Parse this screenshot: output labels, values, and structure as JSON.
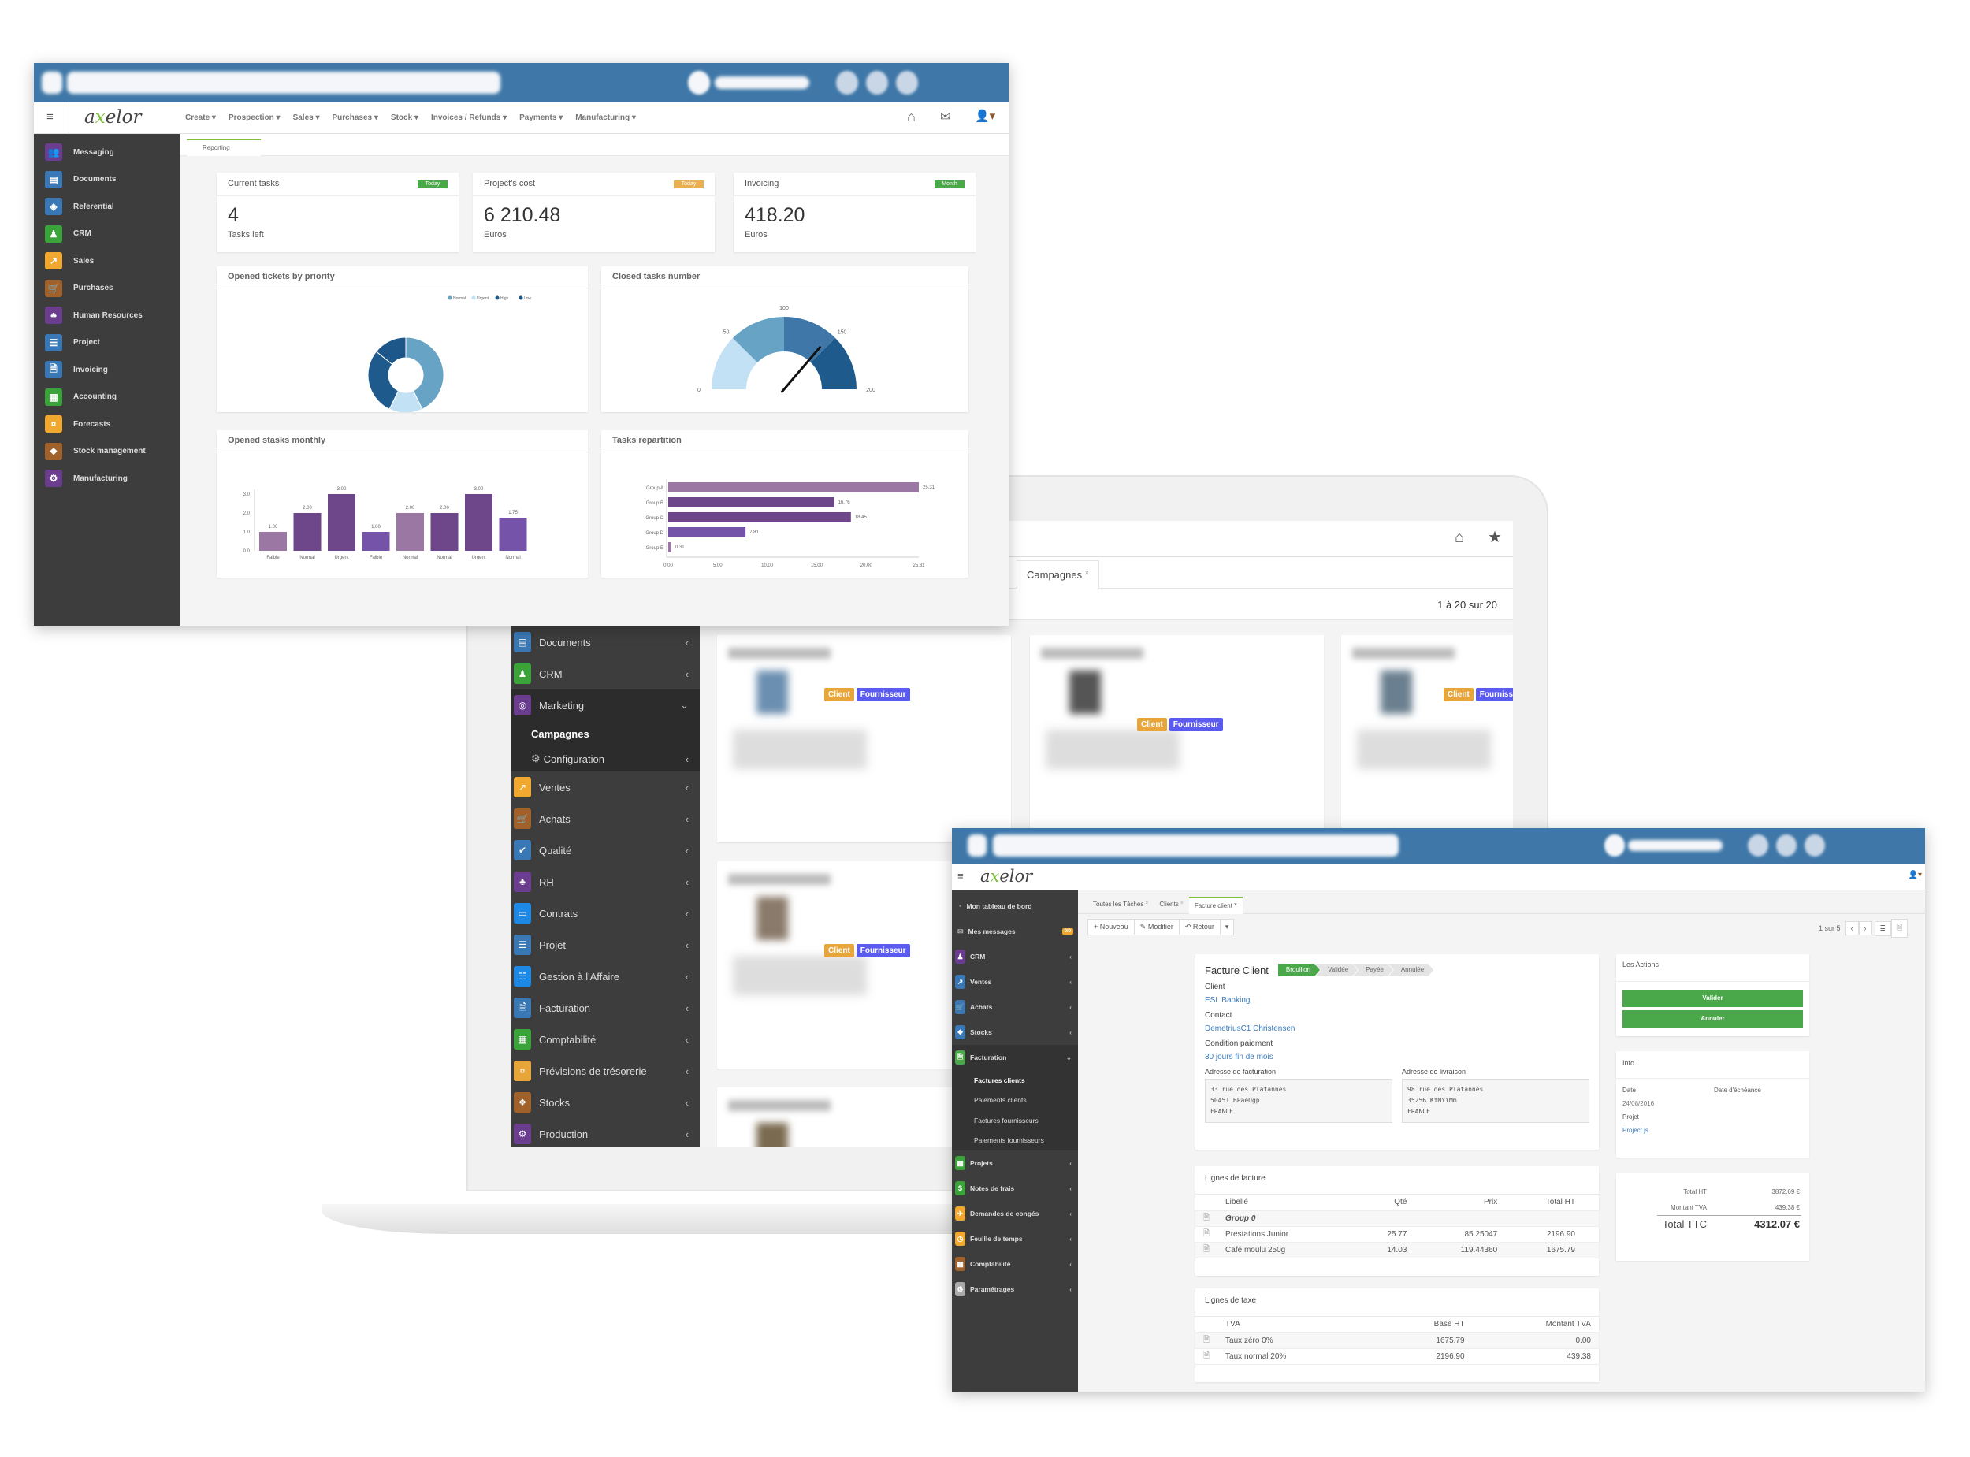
{
  "dashboard": {
    "logo": "axelor",
    "menu": [
      "Create",
      "Prospection",
      "Sales",
      "Purchases",
      "Stock",
      "Invoices / Refunds",
      "Payments",
      "Manufacturing"
    ],
    "tab": "Reporting",
    "sidebar": [
      {
        "label": "Messaging",
        "color": "#6a3d8f",
        "icon": "users-icon"
      },
      {
        "label": "Documents",
        "color": "#3a78b5",
        "icon": "document-icon"
      },
      {
        "label": "Referential",
        "color": "#3a78b5",
        "icon": "cube-icon"
      },
      {
        "label": "CRM",
        "color": "#3aa33a",
        "icon": "user-icon"
      },
      {
        "label": "Sales",
        "color": "#f0a830",
        "icon": "chart-line-icon"
      },
      {
        "label": "Purchases",
        "color": "#a0612a",
        "icon": "cart-icon"
      },
      {
        "label": "Human Resources",
        "color": "#6a3d8f",
        "icon": "sitemap-icon"
      },
      {
        "label": "Project",
        "color": "#3a78b5",
        "icon": "tasks-icon"
      },
      {
        "label": "Invoicing",
        "color": "#3a78b5",
        "icon": "invoice-icon"
      },
      {
        "label": "Accounting",
        "color": "#3aa33a",
        "icon": "calculator-icon"
      },
      {
        "label": "Forecasts",
        "color": "#f0a830",
        "icon": "money-icon"
      },
      {
        "label": "Stock management",
        "color": "#a0612a",
        "icon": "boxes-icon"
      },
      {
        "label": "Manufacturing",
        "color": "#6a3d8f",
        "icon": "cogs-icon"
      }
    ],
    "kpis": [
      {
        "title": "Current tasks",
        "tag": "Today",
        "tag_color": "#4aa84a",
        "value": "4",
        "unit": "Tasks left"
      },
      {
        "title": "Project's cost",
        "tag": "Today",
        "tag_color": "#e8b050",
        "value": "6 210.48",
        "unit": "Euros"
      },
      {
        "title": "Invoicing",
        "tag": "Month",
        "tag_color": "#4aa84a",
        "value": "418.20",
        "unit": "Euros"
      }
    ]
  },
  "chart_data": [
    {
      "type": "pie",
      "title": "Opened tickets by priority",
      "donut": true,
      "legend": "top-right",
      "slices": [
        {
          "name": "Normal",
          "value": 3,
          "color": "#67a3c4"
        },
        {
          "name": "Urgent",
          "value": 1,
          "color": "#c3e1f5"
        },
        {
          "name": "High",
          "value": 2,
          "color": "#1f5a8c"
        },
        {
          "name": "Low",
          "value": 1,
          "color": "#1d5689"
        }
      ]
    },
    {
      "type": "gauge",
      "title": "Closed tasks number",
      "range": [
        0,
        200
      ],
      "ticks": [
        "0",
        "50",
        "100",
        "150",
        "200"
      ],
      "value": 145,
      "bands": [
        {
          "from": 0,
          "to": 50,
          "color": "#c3e1f5"
        },
        {
          "from": 50,
          "to": 100,
          "color": "#67a3c4"
        },
        {
          "from": 100,
          "to": 150,
          "color": "#3f78a8"
        },
        {
          "from": 150,
          "to": 200,
          "color": "#1f5a8c"
        }
      ]
    },
    {
      "type": "bar",
      "title": "Opened stasks monthly",
      "categories": [
        "Faible",
        "Normal",
        "Urgent",
        "Faible",
        "Normal",
        "Normal",
        "Urgent",
        "Normal"
      ],
      "values": [
        1.0,
        2.0,
        3.0,
        1.0,
        2.0,
        2.0,
        3.0,
        1.75
      ],
      "labels": [
        "1.00",
        "2.00",
        "3.00",
        "1.00",
        "2.00",
        "2.00",
        "3.00",
        "1.75"
      ],
      "colors": [
        "#9a78a3",
        "#6e468a",
        "#6e468a",
        "#7553a8",
        "#9a78a3",
        "#6e468a",
        "#6e468a",
        "#7553a8"
      ],
      "ylim": [
        0,
        3
      ],
      "yticks": [
        "0.0",
        "1.0",
        "2.0",
        "3.0"
      ]
    },
    {
      "type": "bar",
      "orientation": "horizontal",
      "title": "Tasks repartition",
      "categories": [
        "Group A",
        "Group B",
        "Group C",
        "Group D",
        "Group E"
      ],
      "values": [
        25.31,
        16.76,
        18.45,
        7.81,
        0.31
      ],
      "labels": [
        "25.31",
        "16.76",
        "18.45",
        "7.81",
        "0.31"
      ],
      "colors": [
        "#9a78a3",
        "#6e468a",
        "#6e468a",
        "#7553a8",
        "#9a78a3"
      ],
      "xlim": [
        0,
        25.31
      ],
      "xticks": [
        "0.00",
        "5.00",
        "10.00",
        "15.00",
        "20.00",
        "25.31"
      ]
    }
  ],
  "laptop": {
    "tab": "Campagnes",
    "pager": "1 à 20 sur 20",
    "sidebar": [
      {
        "label": "Documents",
        "color": "#3a78b5",
        "icon": "document-icon"
      },
      {
        "label": "CRM",
        "color": "#3aa33a",
        "icon": "user-icon"
      },
      {
        "label": "Marketing",
        "color": "#6a3d8f",
        "icon": "bullseye-icon",
        "expanded": true
      },
      {
        "label": "Campagnes",
        "sub": true,
        "active": true
      },
      {
        "label": "Configuration",
        "sub": true,
        "icon": "gear-icon"
      },
      {
        "label": "Ventes",
        "color": "#f0a830",
        "icon": "chart-line-icon"
      },
      {
        "label": "Achats",
        "color": "#a0612a",
        "icon": "cart-icon"
      },
      {
        "label": "Qualité",
        "color": "#3a78b5",
        "icon": "check-icon"
      },
      {
        "label": "RH",
        "color": "#6a3d8f",
        "icon": "sitemap-icon"
      },
      {
        "label": "Contrats",
        "color": "#1e88e5",
        "icon": "briefcase-icon"
      },
      {
        "label": "Projet",
        "color": "#3a78b5",
        "icon": "tasks-icon"
      },
      {
        "label": "Gestion à l'Affaire",
        "color": "#1e88e5",
        "icon": "list-icon"
      },
      {
        "label": "Facturation",
        "color": "#3a78b5",
        "icon": "invoice-icon"
      },
      {
        "label": "Comptabilité",
        "color": "#3aa33a",
        "icon": "calculator-icon"
      },
      {
        "label": "Prévisions de trésorerie",
        "color": "#e8a63a",
        "icon": "money-icon"
      },
      {
        "label": "Stocks",
        "color": "#a0612a",
        "icon": "boxes-icon"
      },
      {
        "label": "Production",
        "color": "#6a3d8f",
        "icon": "cogs-icon"
      }
    ],
    "badges": {
      "client": "Client",
      "supplier": "Fournisseur",
      "client_color": "#e8a63a",
      "supplier_color": "#5b5bf0"
    }
  },
  "invoice_app": {
    "logo": "axelor",
    "sidebar": [
      {
        "label": "Mon tableau de bord",
        "icon": "dashboard-icon",
        "plain": true
      },
      {
        "label": "Mes messages",
        "icon": "envelope-icon",
        "plain": true,
        "badge": "0/0"
      },
      {
        "label": "CRM",
        "color": "#6a3d8f",
        "icon": "user-icon"
      },
      {
        "label": "Ventes",
        "color": "#3a78b5",
        "icon": "chart-line-icon"
      },
      {
        "label": "Achats",
        "color": "#3a78b5",
        "icon": "cart-icon"
      },
      {
        "label": "Stocks",
        "color": "#3a78b5",
        "icon": "boxes-icon"
      },
      {
        "label": "Facturation",
        "color": "#4aa84a",
        "icon": "invoice-icon",
        "expanded": true
      },
      {
        "label": "Factures clients",
        "sub": true,
        "active": true
      },
      {
        "label": "Paiements clients",
        "sub": true
      },
      {
        "label": "Factures fournisseurs",
        "sub": true
      },
      {
        "label": "Paiements fournisseurs",
        "sub": true
      },
      {
        "label": "Projets",
        "color": "#3aa33a",
        "icon": "calculator-icon"
      },
      {
        "label": "Notes de frais",
        "color": "#3aa33a",
        "icon": "dollar-icon"
      },
      {
        "label": "Demandes de congés",
        "color": "#f0a830",
        "icon": "plane-icon"
      },
      {
        "label": "Feuille de temps",
        "color": "#f0a830",
        "icon": "clock-icon"
      },
      {
        "label": "Comptabilité",
        "color": "#a0612a",
        "icon": "calculator-icon"
      },
      {
        "label": "Paramétrages",
        "color": "#aaaaaa",
        "icon": "gear-icon"
      }
    ],
    "tabs": [
      "Toutes les Tâches",
      "Clients",
      "Facture client"
    ],
    "toolbar": {
      "new": "Nouveau",
      "edit": "Modifier",
      "back": "Retour"
    },
    "pager": "1 sur 5",
    "form": {
      "title": "Facture Client",
      "statuses": [
        "Brouillon",
        "Validée",
        "Payée",
        "Annulée"
      ],
      "client_label": "Client",
      "client": "ESL Banking",
      "contact_label": "Contact",
      "contact": "DemetriusC1 Christensen",
      "payment_label": "Condition paiement",
      "payment": "30 jours fin de mois",
      "billing_label": "Adresse de facturation",
      "billing": [
        "33 rue des Platannes",
        "50451 BPaeQgp",
        "FRANCE"
      ],
      "delivery_label": "Adresse de livraison",
      "delivery": [
        "98 rue des Platannes",
        "35256 KfMYiMm",
        "FRANCE"
      ]
    },
    "lines": {
      "title": "Lignes de facture",
      "headers": [
        "Libellé",
        "Qté",
        "Prix",
        "Total HT"
      ],
      "rows": [
        {
          "label": "Group 0",
          "qty": "",
          "price": "",
          "total": ""
        },
        {
          "label": "Prestations Junior",
          "qty": "25.77",
          "price": "85.25047",
          "total": "2196.90"
        },
        {
          "label": "Café moulu 250g",
          "qty": "14.03",
          "price": "119.44360",
          "total": "1675.79"
        }
      ]
    },
    "taxes": {
      "title": "Lignes de taxe",
      "headers": [
        "TVA",
        "Base HT",
        "Montant TVA"
      ],
      "rows": [
        {
          "label": "Taux zéro 0%",
          "base": "1675.79",
          "amount": "0.00"
        },
        {
          "label": "Taux normal 20%",
          "base": "2196.90",
          "amount": "439.38"
        }
      ]
    },
    "actions": {
      "title": "Les Actions",
      "validate": "Valider",
      "cancel": "Annuler"
    },
    "info": {
      "title": "Info.",
      "date_label": "Date",
      "date": "24/08/2016",
      "due_label": "Date d'échéance",
      "project_label": "Projet",
      "project": "Project.js"
    },
    "totals": {
      "ht_label": "Total HT",
      "ht": "3872.69 €",
      "tva_label": "Montant TVA",
      "tva": "439.38 €",
      "ttc_label": "Total TTC",
      "ttc": "4312.07 €"
    }
  }
}
